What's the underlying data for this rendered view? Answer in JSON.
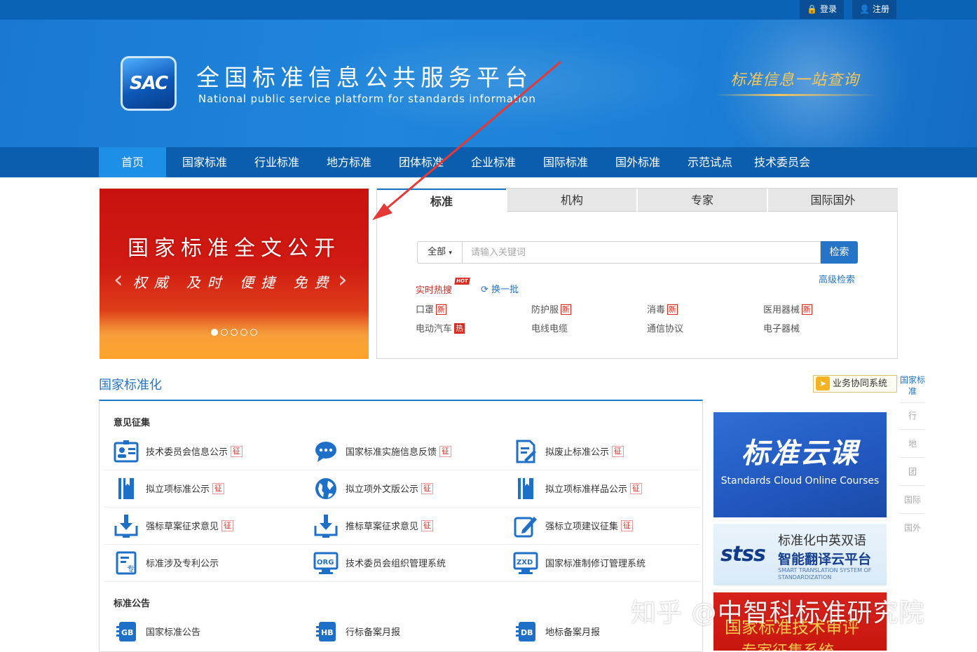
{
  "topbar": {
    "login": "登录",
    "register": "注册"
  },
  "header": {
    "logo_text": "SAC",
    "title_cn": "全国标准信息公共服务平台",
    "title_en": "National public service platform  for standards information",
    "slogan": "标准信息一站查询"
  },
  "nav": [
    "首页",
    "国家标准",
    "行业标准",
    "地方标准",
    "团体标准",
    "企业标准",
    "国际标准",
    "国外标准",
    "示范试点",
    "技术委员会"
  ],
  "slider": {
    "headline": "国家标准全文公开",
    "tagline": "权威 及时 便捷 免费",
    "prev": "‹",
    "next": "›"
  },
  "search": {
    "tabs": [
      "标准",
      "机构",
      "专家",
      "国际国外"
    ],
    "category": "全部",
    "placeholder": "请输入关键词",
    "button": "检索",
    "advanced": "高级检索",
    "hot_label": "实时热搜",
    "hot_badge": "HOT",
    "refresh": "换一批",
    "hot_words": [
      {
        "text": "口罩",
        "badge": "新",
        "badge_type": "new"
      },
      {
        "text": "防护服",
        "badge": "新",
        "badge_type": "new"
      },
      {
        "text": "消毒",
        "badge": "新",
        "badge_type": "new"
      },
      {
        "text": "医用器械",
        "badge": "新",
        "badge_type": "new"
      },
      {
        "text": "电动汽车",
        "badge": "热",
        "badge_type": "hot"
      },
      {
        "text": "电线电缆",
        "badge": "",
        "badge_type": ""
      },
      {
        "text": "通信协议",
        "badge": "",
        "badge_type": ""
      },
      {
        "text": "电子器械",
        "badge": "",
        "badge_type": ""
      }
    ]
  },
  "section": {
    "title": "国家标准化",
    "biz_button": "业务协同系统",
    "group1": "意见征集",
    "group2": "标准公告",
    "items": [
      {
        "text": "技术委员会信息公示",
        "tag": "征",
        "icon": "id-card-icon"
      },
      {
        "text": "国家标准实施信息反馈",
        "tag": "征",
        "icon": "chat-bubble-icon"
      },
      {
        "text": "拟废止标准公示",
        "tag": "征",
        "icon": "document-edit-icon"
      },
      {
        "text": "拟立项标准公示",
        "tag": "征",
        "icon": "book-icon"
      },
      {
        "text": "拟立项外文版公示",
        "tag": "征",
        "icon": "globe-icon"
      },
      {
        "text": "拟立项标准样品公示",
        "tag": "征",
        "icon": "book-icon"
      },
      {
        "text": "强标草案征求意见",
        "tag": "征",
        "icon": "download-icon"
      },
      {
        "text": "推标草案征求意见",
        "tag": "征",
        "icon": "download-icon"
      },
      {
        "text": "强标立项建议征集",
        "tag": "征",
        "icon": "pencil-icon"
      },
      {
        "text": "标准涉及专利公示",
        "tag": "",
        "icon": "patent-doc-icon"
      },
      {
        "text": "技术委员会组织管理系统",
        "tag": "",
        "icon": "org-monitor-icon"
      },
      {
        "text": "国家标准制修订管理系统",
        "tag": "",
        "icon": "zxd-monitor-icon"
      }
    ],
    "announcements": [
      {
        "text": "国家标准公告",
        "icon": "gb-icon",
        "code": "GB"
      },
      {
        "text": "行标备案月报",
        "icon": "hb-icon",
        "code": "HB"
      },
      {
        "text": "地标备案月报",
        "icon": "db-icon",
        "code": "DB"
      }
    ]
  },
  "promos": {
    "cloud_title": "标准云课",
    "cloud_en": "Standards Cloud Online Courses",
    "stss_logo": "stss",
    "stss_line1": "标准化中英双语",
    "stss_line2": "智能翻译云平台",
    "stss_line3": "SMART TRANSLATION SYSTEM OF STANDARDIZATION",
    "review_line1": "国家标准技术审评",
    "review_line2": "专家征集系统"
  },
  "sidenav": [
    "国家标准",
    "行",
    "地",
    "团",
    "国际",
    "国外"
  ],
  "watermark": "知乎 @中智科标准研究院",
  "colors": {
    "primary": "#1a7bd0",
    "nav": "#0b5eae",
    "accent_red": "#d92b1f",
    "annotation": "#e53935"
  }
}
